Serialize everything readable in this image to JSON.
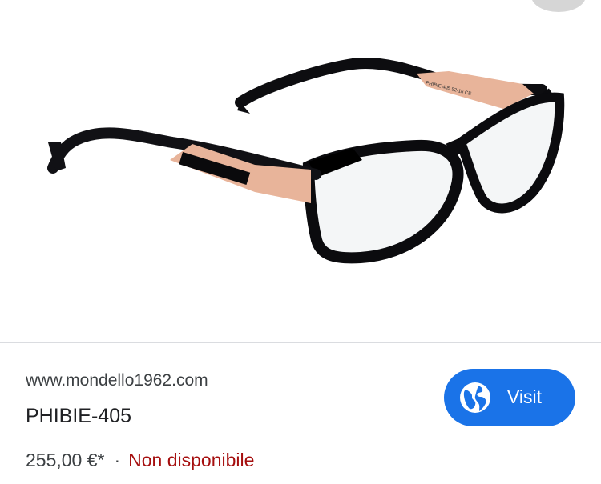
{
  "image": {
    "description_icon": "eyeglasses-product-photo",
    "temple_engraving": "PHIBIE   405   52-16  CE"
  },
  "result": {
    "source_url": "www.mondello1962.com",
    "title": "PHIBIE-405",
    "price": "255,00 €*",
    "separator": "·",
    "availability": "Non disponibile",
    "availability_color": "#a50e0e"
  },
  "visit_button": {
    "label": "Visit",
    "icon": "globe-icon",
    "color": "#1a73e8"
  }
}
